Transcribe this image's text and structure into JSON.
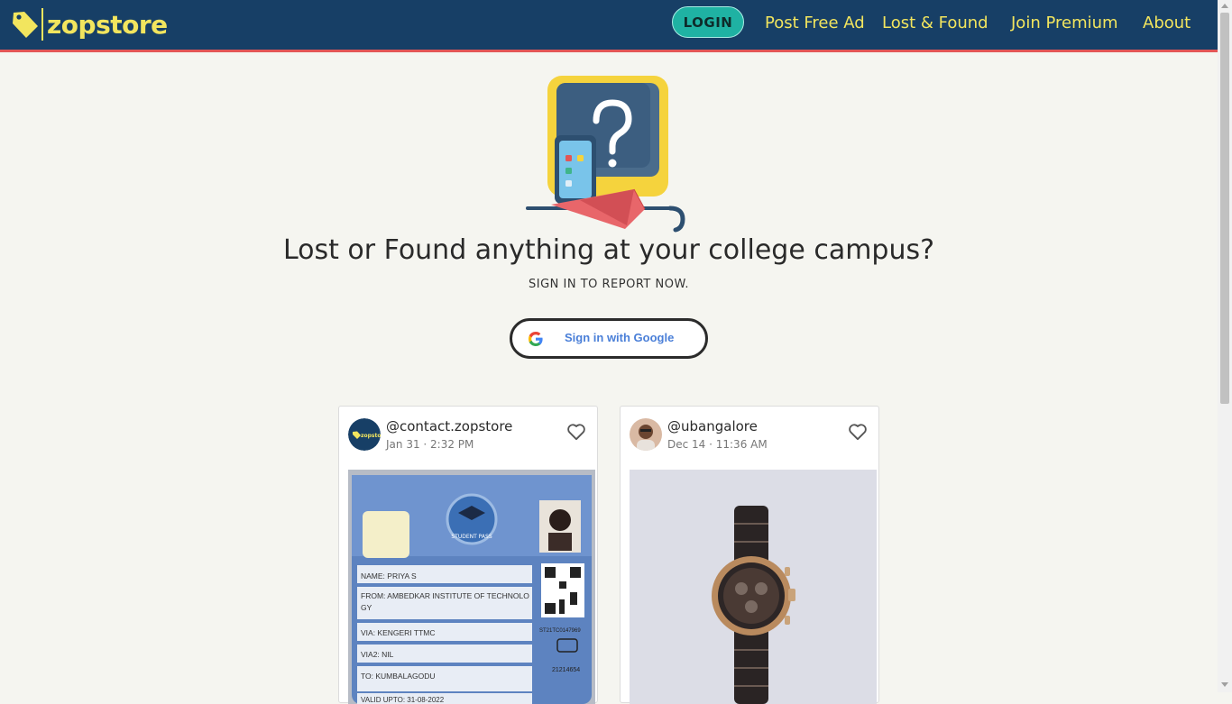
{
  "brand": {
    "name": "zopstore",
    "color": "#f2e55e"
  },
  "nav": {
    "login_label": "LOGIN",
    "links": [
      "Post Free Ad",
      "Lost & Found",
      "Join Premium",
      "About"
    ]
  },
  "hero": {
    "headline": "Lost or Found anything at your college campus?",
    "subline": "SIGN IN TO REPORT NOW.",
    "google_button_label": "Sign in with Google"
  },
  "posts": [
    {
      "handle": "@contact.zopstore",
      "timestamp": "Jan 31 · 2:32 PM",
      "image": "student-pass-id-card",
      "card_text": {
        "pass_title": "STUDENT PASS",
        "name": "NAME: PRIYA S",
        "from": "FROM: AMBEDKAR INSTITUTE OF TECHNOLO",
        "from_cont": "GY",
        "via": "VIA: KENGERI TTMC",
        "via2": "VIA2: NIL",
        "to": "TO: KUMBALAGODU",
        "valid": "VALID UPTO: 31-08-2022",
        "code1": "ST21TC0147969",
        "code2": "21214654"
      }
    },
    {
      "handle": "@ubangalore",
      "timestamp": "Dec 14 · 11:36 AM",
      "image": "wrist-watch"
    }
  ],
  "colors": {
    "header_bg": "#173f66",
    "header_border": "#e25656",
    "accent": "#1fb2a3",
    "page_bg": "#f5f5f0"
  }
}
